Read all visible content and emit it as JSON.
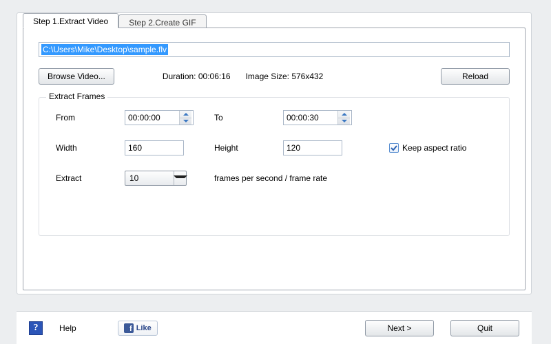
{
  "tabs": {
    "step1": "Step 1.Extract Video",
    "step2": "Step 2.Create GIF"
  },
  "path": {
    "value": "C:\\Users\\Mike\\Desktop\\sample.flv"
  },
  "buttons": {
    "browse": "Browse Video...",
    "reload": "Reload",
    "next": "Next >",
    "quit": "Quit"
  },
  "info": {
    "duration_label": "Duration:",
    "duration_value": "00:06:16",
    "size_label": "Image Size:",
    "size_value": "576x432"
  },
  "group": {
    "title": "Extract Frames",
    "from_label": "From",
    "from_value": "00:00:00",
    "to_label": "To",
    "to_value": "00:00:30",
    "width_label": "Width",
    "width_value": "160",
    "height_label": "Height",
    "height_value": "120",
    "keep_aspect_label": "Keep aspect ratio",
    "keep_aspect_checked": true,
    "extract_label": "Extract",
    "extract_value": "10",
    "fps_caption": "frames per second / frame rate"
  },
  "bottom": {
    "help_label": "Help",
    "like_label": "Like"
  }
}
